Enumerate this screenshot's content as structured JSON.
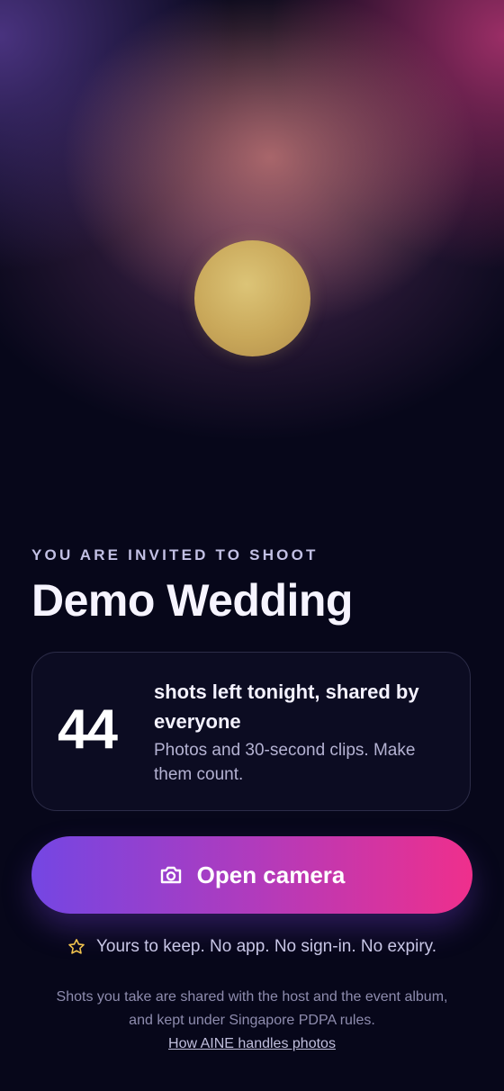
{
  "hero": {
    "orb_color": "#d2b46a"
  },
  "invitation": {
    "label": "YOU ARE INVITED TO SHOOT",
    "event_name": "Demo Wedding"
  },
  "shots": {
    "count": "44",
    "headline": "shots left tonight, shared by everyone",
    "subtext": "Photos and 30-second clips. Make them count."
  },
  "camera_button": {
    "label": "Open camera",
    "icon": "camera-icon",
    "gradient": [
      "#7446e3",
      "#b03bbd",
      "#ef2f8c"
    ]
  },
  "keep": {
    "icon": "star-icon",
    "icon_color": "#f1c34e",
    "text": "Yours to keep. No app. No sign-in. No expiry."
  },
  "footer": {
    "line1": "Shots you take are shared with the host and the event album,",
    "line2": "and kept under Singapore PDPA rules.",
    "link_text": "How AINE handles photos"
  },
  "colors": {
    "background": "#07071a",
    "accent_purple": "#7446e3",
    "accent_pink": "#ef2f8c"
  }
}
